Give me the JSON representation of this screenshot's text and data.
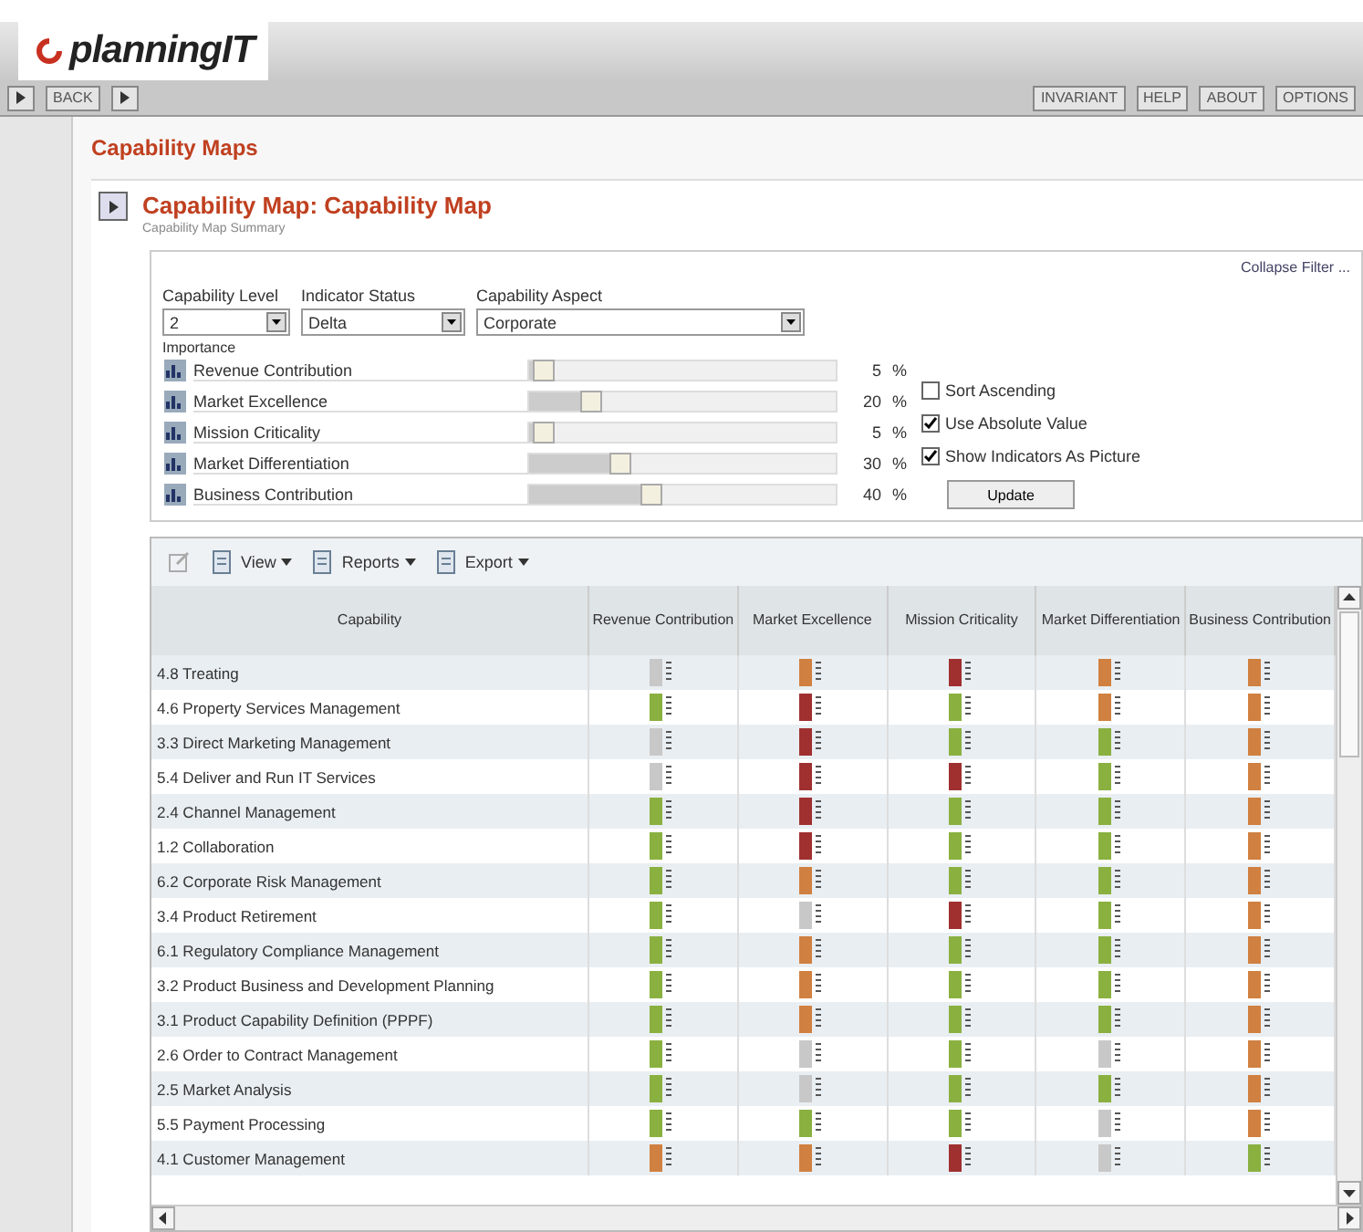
{
  "app": {
    "logo": "planningIT",
    "back_button": "BACK",
    "top_buttons": [
      "INVARIANT",
      "HELP",
      "ABOUT",
      "OPTIONS"
    ]
  },
  "page_title": "Capability Maps",
  "section": {
    "title": "Capability Map: Capability Map",
    "subtitle": "Capability Map Summary"
  },
  "filter": {
    "collapse_link": "Collapse Filter ...",
    "fields": [
      {
        "label": "Capability Level",
        "value": "2"
      },
      {
        "label": "Indicator Status",
        "value": "Delta"
      },
      {
        "label": "Capability Aspect",
        "value": "Corporate"
      }
    ],
    "importance_label": "Importance",
    "weights": [
      {
        "name": "Revenue Contribution",
        "level": 0.05,
        "value": "5",
        "unit": "%"
      },
      {
        "name": "Market Excellence",
        "level": 0.2,
        "value": "20",
        "unit": "%"
      },
      {
        "name": "Mission Criticality",
        "level": 0.05,
        "value": "5",
        "unit": "%"
      },
      {
        "name": "Market Differentiation",
        "level": 0.3,
        "value": "30",
        "unit": "%"
      },
      {
        "name": "Business Contribution",
        "level": 0.4,
        "value": "40",
        "unit": "%"
      }
    ],
    "options": [
      {
        "label": "Sort Ascending",
        "checked": false
      },
      {
        "label": "Use Absolute Value",
        "checked": true
      },
      {
        "label": "Show Indicators As Picture",
        "checked": true
      }
    ],
    "update_button": "Update"
  },
  "grid_toolbar": [
    "View",
    "Reports",
    "Export"
  ],
  "table": {
    "columns": [
      "Capability",
      "Revenue Contribution",
      "Market Excellence",
      "Mission Criticality",
      "Market Differentiation",
      "Business Contribution"
    ],
    "rows": [
      {
        "name": "4.8 Treating",
        "cells": [
          {
            "color": "#c8c8c8"
          },
          {
            "color": "#d08040"
          },
          {
            "color": "#a03030"
          },
          {
            "color": "#d08040"
          },
          {
            "color": "#d08040"
          }
        ]
      },
      {
        "name": "4.6 Property Services Management",
        "cells": [
          {
            "color": "#8ab040"
          },
          {
            "color": "#a03030"
          },
          {
            "color": "#8ab040"
          },
          {
            "color": "#d08040"
          },
          {
            "color": "#d08040"
          }
        ]
      },
      {
        "name": "3.3 Direct Marketing Management",
        "cells": [
          {
            "color": "#c8c8c8"
          },
          {
            "color": "#a03030"
          },
          {
            "color": "#8ab040"
          },
          {
            "color": "#8ab040"
          },
          {
            "color": "#d08040"
          }
        ]
      },
      {
        "name": "5.4 Deliver and Run IT Services",
        "cells": [
          {
            "color": "#c8c8c8"
          },
          {
            "color": "#a03030"
          },
          {
            "color": "#a03030"
          },
          {
            "color": "#8ab040"
          },
          {
            "color": "#d08040"
          }
        ]
      },
      {
        "name": "2.4 Channel Management",
        "cells": [
          {
            "color": "#8ab040"
          },
          {
            "color": "#a03030"
          },
          {
            "color": "#8ab040"
          },
          {
            "color": "#8ab040"
          },
          {
            "color": "#d08040"
          }
        ]
      },
      {
        "name": "1.2 Collaboration",
        "cells": [
          {
            "color": "#8ab040"
          },
          {
            "color": "#a03030"
          },
          {
            "color": "#8ab040"
          },
          {
            "color": "#8ab040"
          },
          {
            "color": "#d08040"
          }
        ]
      },
      {
        "name": "6.2 Corporate Risk Management",
        "cells": [
          {
            "color": "#8ab040"
          },
          {
            "color": "#d08040"
          },
          {
            "color": "#8ab040"
          },
          {
            "color": "#8ab040"
          },
          {
            "color": "#d08040"
          }
        ]
      },
      {
        "name": "3.4 Product Retirement",
        "cells": [
          {
            "color": "#8ab040"
          },
          {
            "color": "#c8c8c8"
          },
          {
            "color": "#a03030"
          },
          {
            "color": "#8ab040"
          },
          {
            "color": "#d08040"
          }
        ]
      },
      {
        "name": "6.1 Regulatory Compliance Management",
        "cells": [
          {
            "color": "#8ab040"
          },
          {
            "color": "#d08040"
          },
          {
            "color": "#8ab040"
          },
          {
            "color": "#8ab040"
          },
          {
            "color": "#d08040"
          }
        ]
      },
      {
        "name": "3.2 Product Business and Development Planning",
        "cells": [
          {
            "color": "#8ab040"
          },
          {
            "color": "#d08040"
          },
          {
            "color": "#8ab040"
          },
          {
            "color": "#8ab040"
          },
          {
            "color": "#d08040"
          }
        ]
      },
      {
        "name": "3.1 Product Capability Definition (PPPF)",
        "cells": [
          {
            "color": "#8ab040"
          },
          {
            "color": "#d08040"
          },
          {
            "color": "#8ab040"
          },
          {
            "color": "#8ab040"
          },
          {
            "color": "#d08040"
          }
        ]
      },
      {
        "name": "2.6 Order to Contract Management",
        "cells": [
          {
            "color": "#8ab040"
          },
          {
            "color": "#c8c8c8"
          },
          {
            "color": "#8ab040"
          },
          {
            "color": "#c8c8c8"
          },
          {
            "color": "#d08040"
          }
        ]
      },
      {
        "name": "2.5 Market Analysis",
        "cells": [
          {
            "color": "#8ab040"
          },
          {
            "color": "#c8c8c8"
          },
          {
            "color": "#8ab040"
          },
          {
            "color": "#8ab040"
          },
          {
            "color": "#d08040"
          }
        ]
      },
      {
        "name": "5.5 Payment Processing",
        "cells": [
          {
            "color": "#8ab040"
          },
          {
            "color": "#8ab040"
          },
          {
            "color": "#8ab040"
          },
          {
            "color": "#c8c8c8"
          },
          {
            "color": "#d08040"
          }
        ]
      },
      {
        "name": "4.1 Customer Management",
        "cells": [
          {
            "color": "#d08040"
          },
          {
            "color": "#d08040"
          },
          {
            "color": "#a03030"
          },
          {
            "color": "#c8c8c8"
          },
          {
            "color": "#8ab040"
          }
        ]
      }
    ]
  }
}
